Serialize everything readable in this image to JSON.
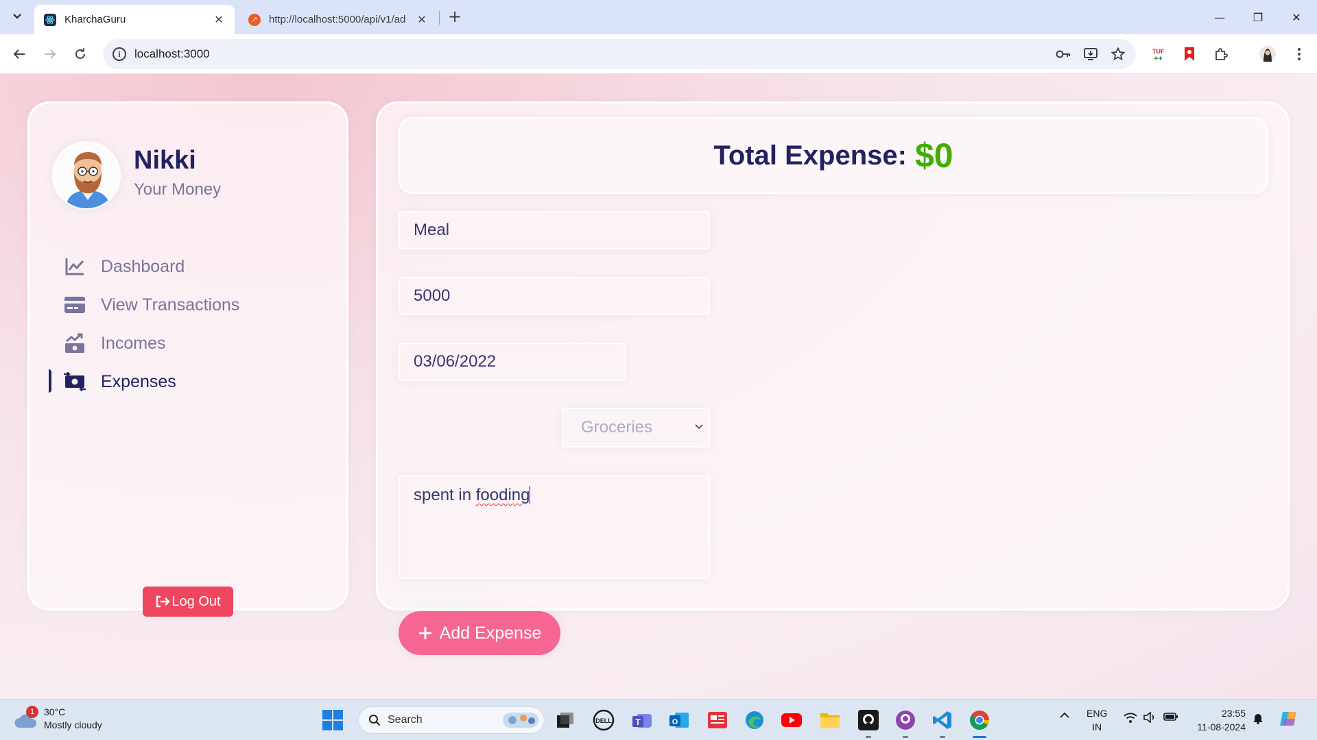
{
  "browser": {
    "tabs": [
      {
        "title": "KharchaGuru",
        "active": true
      },
      {
        "title": "http://localhost:5000/api/v1/ad",
        "active": false
      }
    ],
    "address": "localhost:3000",
    "window_controls": {
      "minimize": "—",
      "restore": "❐",
      "close": "✕"
    },
    "tab_close": "✕",
    "new_tab": "+"
  },
  "user": {
    "name": "Nikki",
    "subtitle": "Your Money"
  },
  "menu": [
    {
      "label": "Dashboard",
      "icon": "chart-line-icon",
      "active": false
    },
    {
      "label": "View Transactions",
      "icon": "credit-card-icon",
      "active": false
    },
    {
      "label": "Incomes",
      "icon": "money-bill-trend-up-icon",
      "active": false
    },
    {
      "label": "Expenses",
      "icon": "money-bill-transfer-icon",
      "active": true
    }
  ],
  "logout_label": "Log Out",
  "total": {
    "label": "Total Expense:",
    "value": "$0"
  },
  "form": {
    "title_value": "Meal",
    "amount_value": "5000",
    "date_value": "03/06/2022",
    "category_value": "Groceries",
    "description_prefix": "spent in ",
    "description_misspelled": "fooding",
    "submit_label": "Add Expense",
    "submit_icon": "+"
  },
  "taskbar": {
    "weather_temp": "30°C",
    "weather_desc": "Mostly cloudy",
    "weather_badge": "1",
    "search_label": "Search",
    "lang_top": "ENG",
    "lang_bottom": "IN",
    "time": "23:55",
    "date": "11-08-2024"
  },
  "colors": {
    "primary_text": "#222260",
    "total_green": "#42ad00",
    "add_button": "#f56692",
    "logout_button": "#f04760"
  }
}
